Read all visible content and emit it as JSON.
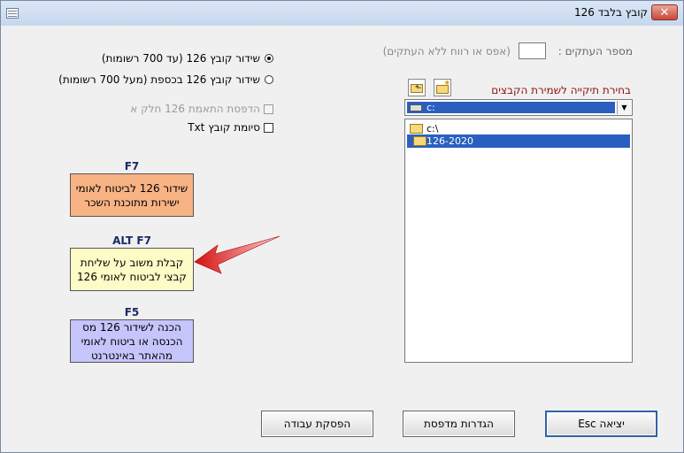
{
  "window": {
    "title": "קובץ בלבד 126",
    "close_label": "✕"
  },
  "options": {
    "radio1": "שידור קובץ 126 (עד 700 רשומות)",
    "radio2": "שידור קובץ 126 בכספת (מעל 700 רשומות)",
    "check1": "הדפסת התאמת 126 חלק א",
    "check2": "סיומת קובץ Txt"
  },
  "copies": {
    "label": "מספר העתקים :",
    "hint": "(אפס או רווח ללא העתקים)",
    "value": ""
  },
  "folder": {
    "label": "בחירת תיקייה לשמירת הקבצים",
    "drive": "c:",
    "tree": [
      "c:\\",
      "126-2020"
    ]
  },
  "actions": [
    {
      "key": "F7",
      "text": "שידור 126 לביטוח לאומי ישירות מתוכנת השכר",
      "color": "#f7b383"
    },
    {
      "key": "ALT F7",
      "text": "קבלת משוב על שליחת קבצי לביטוח לאומי 126",
      "color": "#fdfcc7"
    },
    {
      "key": "F5",
      "text": "הכנה לשידור 126 מס הכנסה או ביטוח לאומי מהאתר באינטרנט",
      "color": "#c5c5fb"
    }
  ],
  "buttons": {
    "stop": "הפסקת עבודה",
    "printer": "הגדרות מדפסת",
    "exit": "יציאה Esc"
  },
  "colors": {
    "arrow": "#e52020",
    "selection": "#2a5fc0"
  }
}
